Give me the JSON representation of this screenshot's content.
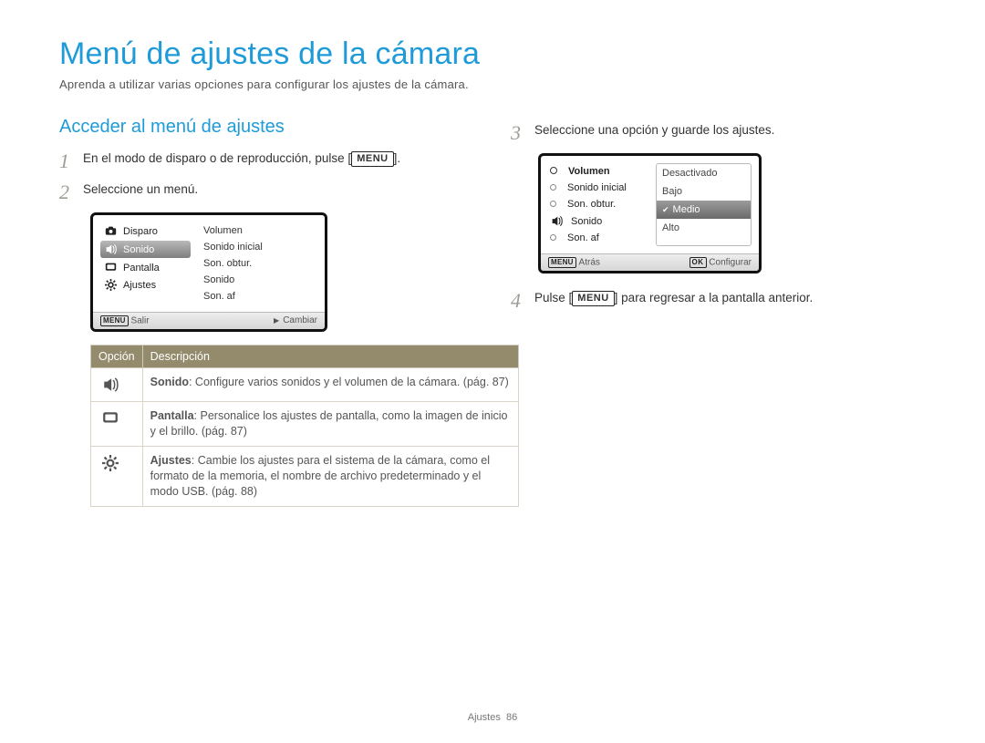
{
  "page": {
    "title": "Menú de ajustes de la cámara",
    "subtitle": "Aprenda a utilizar varias opciones para configurar los ajustes de la cámara."
  },
  "section": {
    "title": "Acceder al menú de ajustes"
  },
  "steps": {
    "s1": {
      "num": "1",
      "pre": "En el modo de disparo o de reproducción, pulse [",
      "btn": "MENU",
      "post": "]."
    },
    "s2": {
      "num": "2",
      "text": "Seleccione un menú."
    },
    "s3": {
      "num": "3",
      "text": "Seleccione una opción y guarde los ajustes."
    },
    "s4": {
      "num": "4",
      "pre": "Pulse [",
      "btn": "MENU",
      "post": "] para regresar a la pantalla anterior."
    }
  },
  "lcd1": {
    "left": {
      "disparo": "Disparo",
      "sonido": "Sonido",
      "pantalla": "Pantalla",
      "ajustes": "Ajustes"
    },
    "right": {
      "volumen": "Volumen",
      "sonido_inicial": "Sonido inicial",
      "son_obtur": "Son. obtur.",
      "sonido": "Sonido",
      "son_af": "Son. af"
    },
    "footer": {
      "left_label": "MENU",
      "left_text": "Salir",
      "right_text": "Cambiar"
    }
  },
  "lcd2": {
    "left": {
      "volumen": "Volumen",
      "sonido_inicial": "Sonido inicial",
      "son_obtur": "Son. obtur.",
      "sonido": "Sonido",
      "son_af": "Son. af"
    },
    "right": {
      "desactivado": "Desactivado",
      "bajo": "Bajo",
      "medio": "Medio",
      "alto": "Alto"
    },
    "footer": {
      "left_label": "MENU",
      "left_text": "Atrás",
      "right_label": "OK",
      "right_text": "Configurar"
    }
  },
  "table": {
    "head": {
      "c1": "Opción",
      "c2": "Descripción"
    },
    "rows": {
      "r1": {
        "label": "Sonido",
        "text": ": Configure varios sonidos y el volumen de la cámara. (pág. 87)"
      },
      "r2": {
        "label": "Pantalla",
        "text": ": Personalice los ajustes de pantalla, como la imagen de inicio y el brillo. (pág. 87)"
      },
      "r3": {
        "label": "Ajustes",
        "text": ": Cambie los ajustes para el sistema de la cámara, como el formato de la memoria, el nombre de archivo predeterminado y el modo USB. (pág. 88)"
      }
    }
  },
  "footer": {
    "section": "Ajustes",
    "page": "86"
  }
}
